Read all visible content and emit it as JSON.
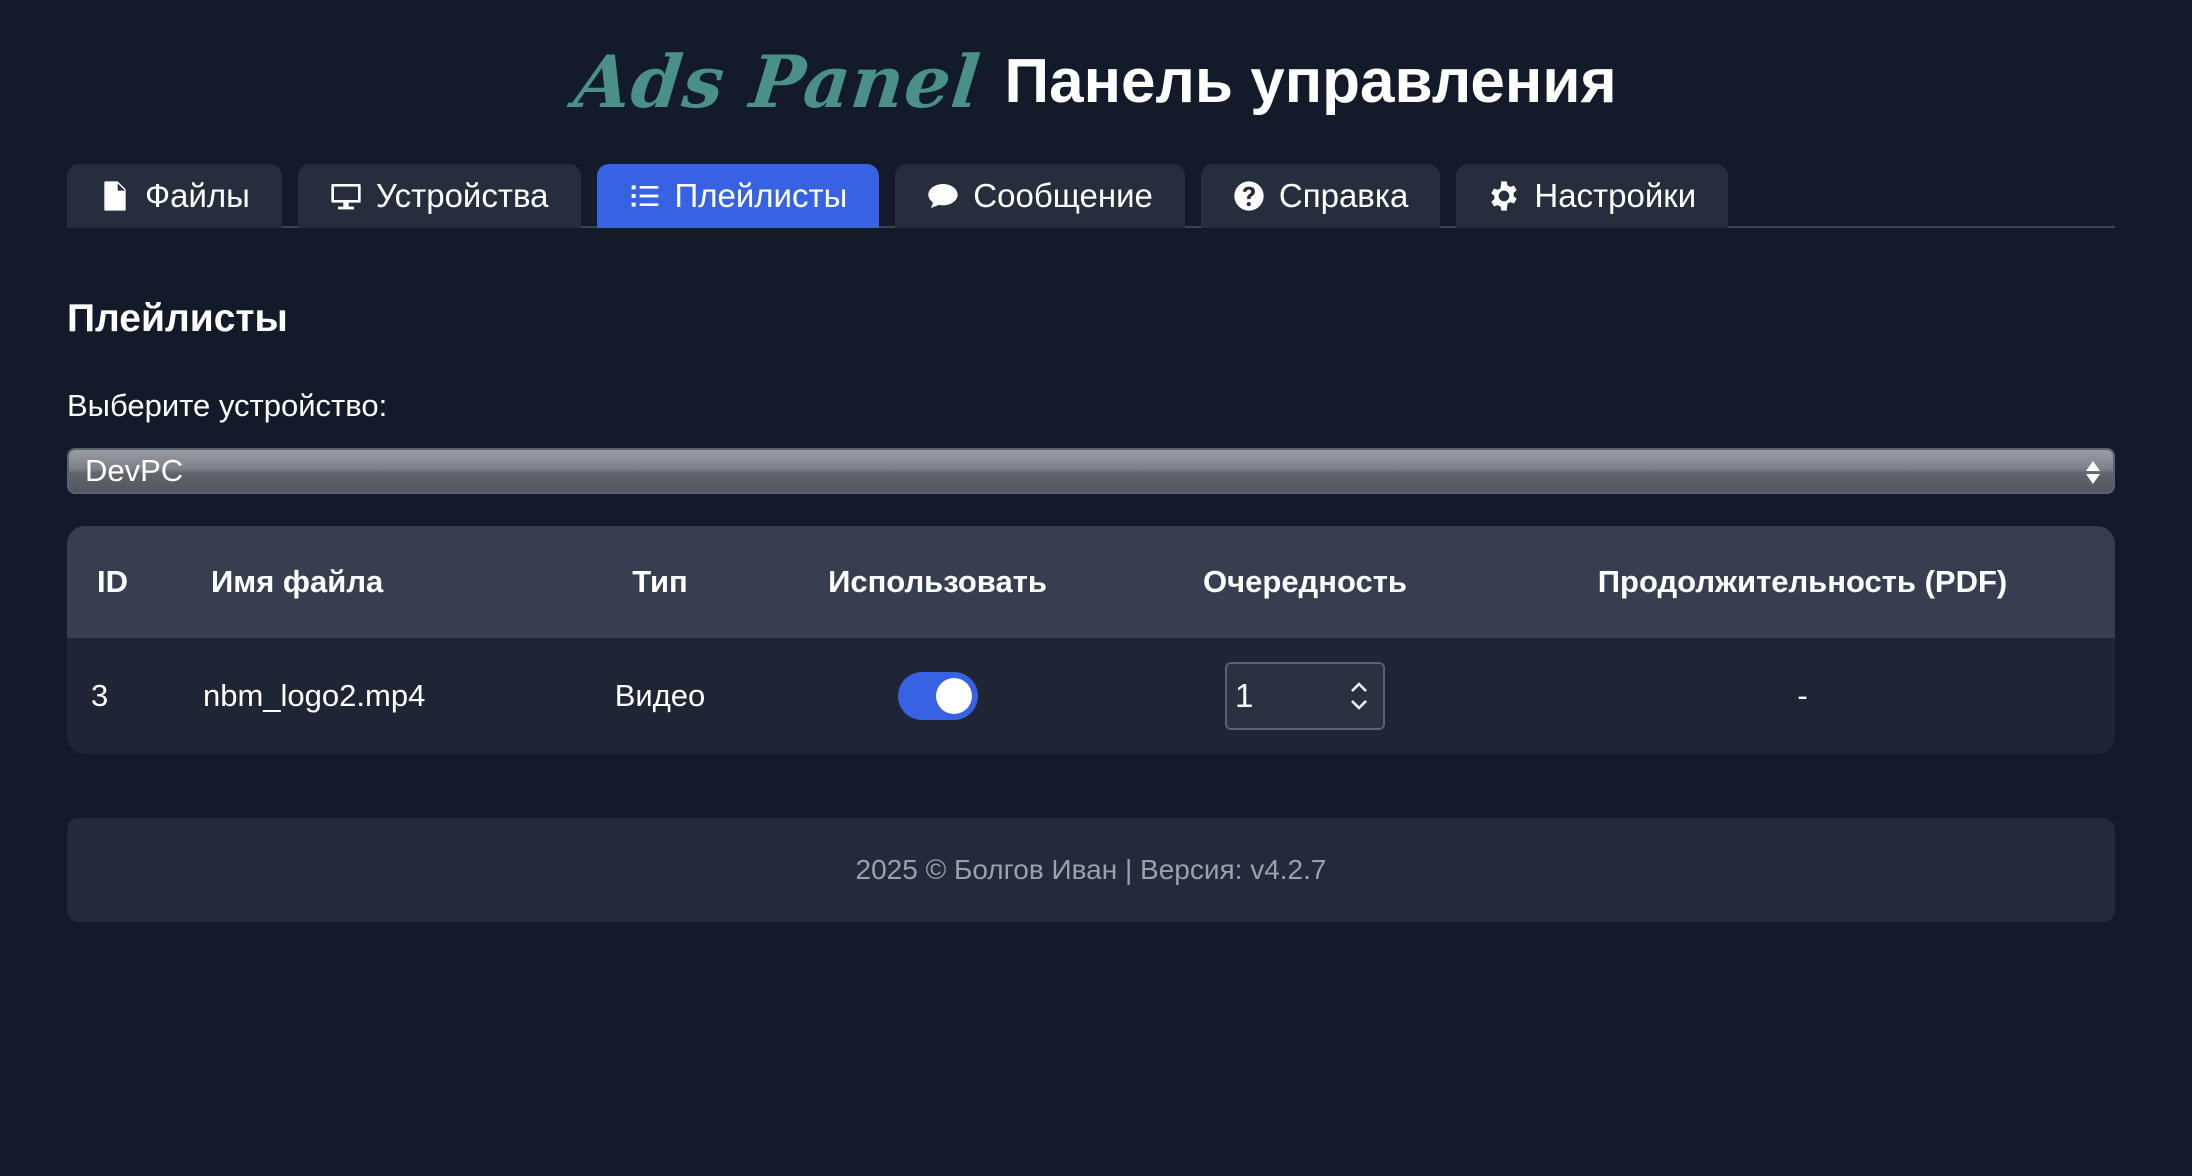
{
  "header": {
    "logo_text": "Ads Panel",
    "title": "Панель управления",
    "logo_color": "#4a8f88"
  },
  "tabs": [
    {
      "label": "Файлы",
      "icon": "file-icon",
      "active": false
    },
    {
      "label": "Устройства",
      "icon": "monitor-icon",
      "active": false
    },
    {
      "label": "Плейлисты",
      "icon": "list-icon",
      "active": true
    },
    {
      "label": "Сообщение",
      "icon": "chat-bubble-icon",
      "active": false
    },
    {
      "label": "Справка",
      "icon": "question-circle-icon",
      "active": false
    },
    {
      "label": "Настройки",
      "icon": "gear-icon",
      "active": false
    }
  ],
  "section": {
    "title": "Плейлисты",
    "select_label": "Выберите устройство:",
    "selected_device": "DevPC"
  },
  "table": {
    "headers": {
      "id": "ID",
      "name": "Имя файла",
      "type": "Тип",
      "use": "Использовать",
      "order": "Очередность",
      "duration": "Продолжительность (PDF)"
    },
    "rows": [
      {
        "id": "3",
        "name": "nbm_logo2.mp4",
        "type": "Видео",
        "use": true,
        "order": "1",
        "duration": "-"
      }
    ]
  },
  "footer": {
    "text": "2025 © Болгов Иван | Версия: v4.2.7"
  },
  "colors": {
    "background": "#131a29",
    "accent": "#3762e4",
    "tab_bg": "#262d3d",
    "table_header_bg": "#373e4f",
    "footer_text": "#9aa1ad"
  }
}
